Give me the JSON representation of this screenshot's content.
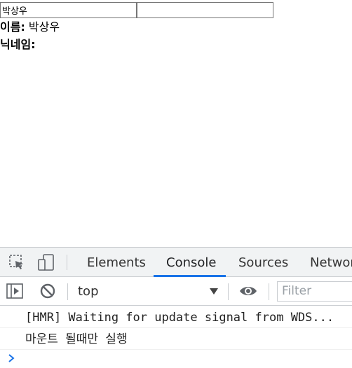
{
  "form": {
    "name_value": "박상우",
    "nickname_value": ""
  },
  "display": {
    "name_label": "이름:",
    "name_value": " 박상우",
    "nickname_label": "닉네임:",
    "nickname_value": ""
  },
  "devtools": {
    "tabs": [
      {
        "label": "Elements"
      },
      {
        "label": "Console"
      },
      {
        "label": "Sources"
      },
      {
        "label": "Network"
      }
    ],
    "active_tab": "Console",
    "context": "top",
    "filter_placeholder": "Filter",
    "messages": [
      "[HMR] Waiting for update signal from WDS...",
      "마운트 될때만 실행"
    ],
    "accent_color": "#1a73e8"
  }
}
